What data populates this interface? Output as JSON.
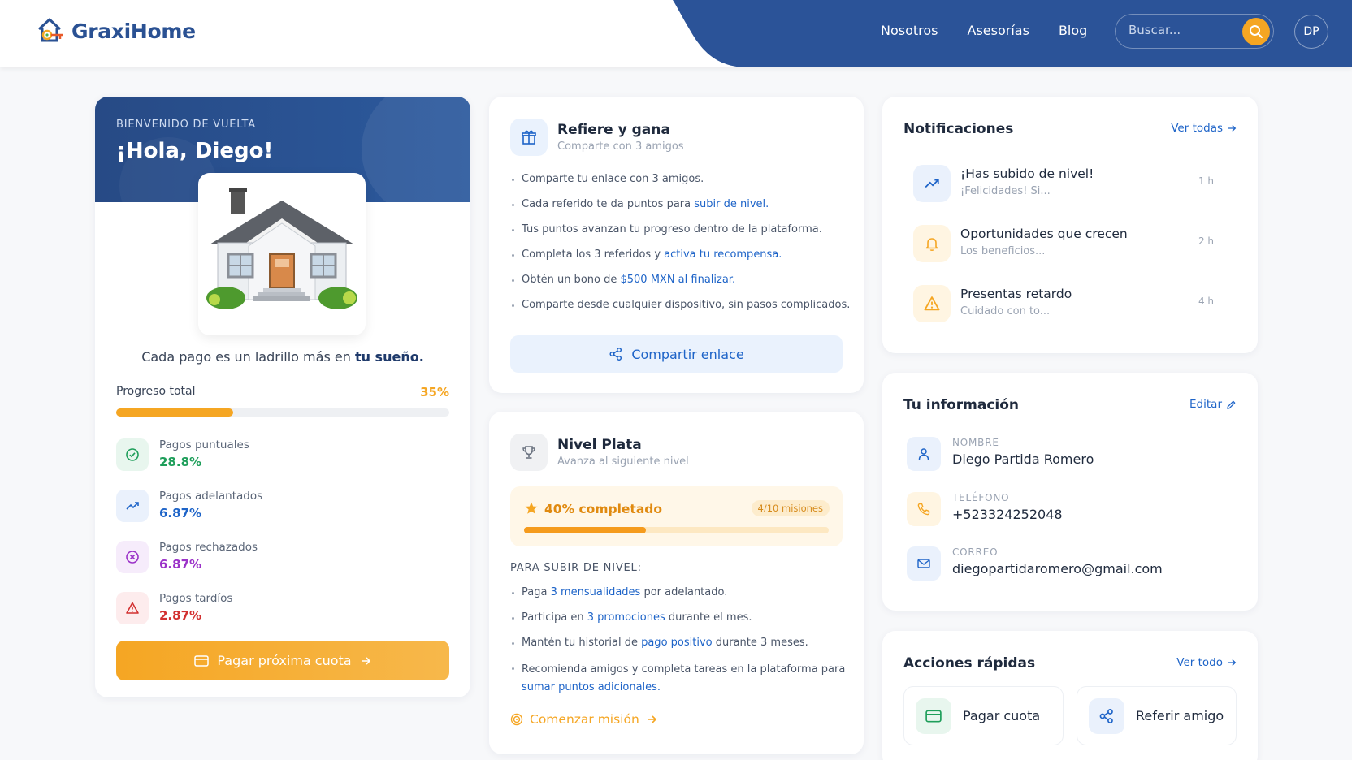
{
  "header": {
    "brand": "GraxiHome",
    "nav": [
      "Nosotros",
      "Asesorías",
      "Blog"
    ],
    "search_placeholder": "Buscar...",
    "avatar_initials": "DP"
  },
  "welcome": {
    "eyebrow": "BIENVENIDO DE VUELTA",
    "greeting": "¡Hola, Diego!",
    "tagline_prefix": "Cada pago es un ladrillo más en",
    "tagline_highlight": "tu sueño.",
    "progress_label": "Progreso total",
    "progress_value": "35%",
    "progress_fraction": 0.35,
    "stats": [
      {
        "label": "Pagos puntuales",
        "value": "28.8%",
        "color": "#1e9e5a",
        "icon": "check-circle-icon"
      },
      {
        "label": "Pagos adelantados",
        "value": "6.87%",
        "color": "#1e64c8",
        "icon": "trending-up-icon"
      },
      {
        "label": "Pagos rechazados",
        "value": "6.87%",
        "color": "#9b32c8",
        "icon": "x-circle-icon"
      },
      {
        "label": "Pagos tardíos",
        "value": "2.87%",
        "color": "#d23030",
        "icon": "warning-icon"
      }
    ],
    "pay_button": "Pagar próxima cuota"
  },
  "refer": {
    "title": "Refiere y gana",
    "subtitle": "Comparte con 3 amigos",
    "bullets": [
      {
        "text": "Comparte tu enlace con 3 amigos.",
        "link": ""
      },
      {
        "text": "Cada referido te da puntos para ",
        "link": "subir de nivel."
      },
      {
        "text": "Tus puntos avanzan tu progreso dentro de la plataforma.",
        "link": ""
      },
      {
        "text": "Completa los 3 referidos y ",
        "link": "activa tu recompensa."
      },
      {
        "text": "Obtén un bono de ",
        "link": "$500 MXN al finalizar."
      },
      {
        "text": "Comparte desde cualquier dispositivo, sin pasos complicados.",
        "link": ""
      }
    ],
    "share_button": "Compartir enlace"
  },
  "level": {
    "title": "Nivel Plata",
    "subtitle": "Avanza al siguiente nivel",
    "mission_label": "40% completado",
    "mission_fraction": 0.4,
    "mission_badge": "4/10 misiones",
    "heading": "PARA SUBIR DE NIVEL:",
    "bullets": [
      {
        "pre": "Paga ",
        "link": "3 mensualidades",
        "post": " por adelantado."
      },
      {
        "pre": "Participa en ",
        "link": "3 promociones",
        "post": " durante el mes."
      },
      {
        "pre": "Mantén tu historial de ",
        "link": "pago positivo",
        "post": " durante 3 meses."
      },
      {
        "pre": "Recomienda amigos y completa tareas en la plataforma para ",
        "link": "sumar puntos adicionales.",
        "post": ""
      }
    ],
    "start_link": "Comenzar misión"
  },
  "notifications": {
    "title": "Notificaciones",
    "view_all": "Ver todas",
    "items": [
      {
        "title": "¡Has subido de nivel!",
        "sub": "¡Felicidades! Si...",
        "time": "1 h",
        "icon": "trending-up-icon"
      },
      {
        "title": "Oportunidades que crecen",
        "sub": "Los beneficios...",
        "time": "2 h",
        "icon": "bell-icon"
      },
      {
        "title": "Presentas retardo",
        "sub": "Cuidado con to...",
        "time": "4 h",
        "icon": "warning-icon"
      }
    ]
  },
  "info": {
    "title": "Tu información",
    "edit": "Editar",
    "fields": [
      {
        "label": "NOMBRE",
        "value": "Diego Partida Romero",
        "icon": "user-icon"
      },
      {
        "label": "TELÉFONO",
        "value": "+523324252048",
        "icon": "phone-icon"
      },
      {
        "label": "CORREO",
        "value": "diegopartidaromero@gmail.com",
        "icon": "mail-icon"
      }
    ]
  },
  "quick": {
    "title": "Acciones rápidas",
    "view_all": "Ver todo",
    "actions": [
      {
        "label": "Pagar cuota",
        "icon": "credit-card-icon"
      },
      {
        "label": "Referir amigo",
        "icon": "share-icon"
      }
    ]
  },
  "colors": {
    "brand_blue": "#2a5193",
    "accent_orange": "#f5a623",
    "link_blue": "#1e64c8"
  }
}
